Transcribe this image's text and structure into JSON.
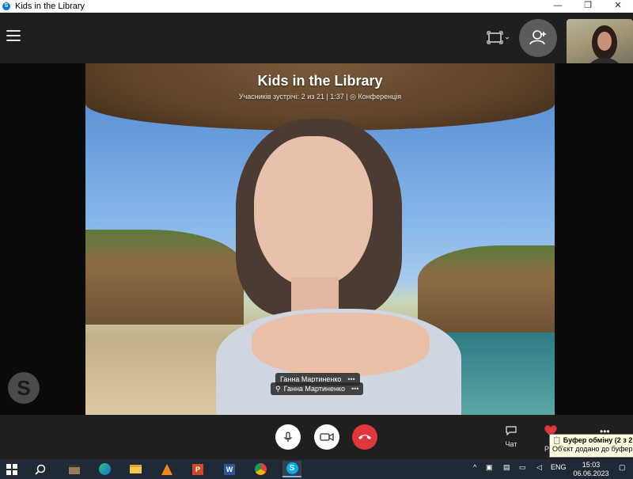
{
  "window": {
    "title": "Kids in the Library",
    "controls": {
      "minimize": "—",
      "maximize": "❐",
      "close": "✕"
    }
  },
  "call": {
    "title": "Kids in the Library",
    "subtitle": "Учасників зустрічі: 2 из 21 | 1:37 | ◎ Конференція"
  },
  "participants": [
    {
      "name": "Ганна Мартиненко",
      "more": "•••"
    },
    {
      "name": "Ганна Мартиненко",
      "more": "•••",
      "muted": true
    }
  ],
  "controls": {
    "chat_label": "Чат",
    "react_label": "Р",
    "more_label": "•••"
  },
  "toast": {
    "title": "Буфер обміну (2 з 2",
    "body": "Об'єкт додано до буфер"
  },
  "taskbar": {
    "lang": "ENG",
    "time": "15:03",
    "date": "06.06.2023",
    "apps": [
      "start-icon",
      "search-icon",
      "clapperboard-icon",
      "edge-icon",
      "file-explorer-icon",
      "vlc-icon",
      "powerpoint-icon",
      "word-icon",
      "chrome-icon",
      "skype-icon"
    ]
  },
  "colors": {
    "accent": "#0078d4",
    "end_call": "#e0373c",
    "bar": "#1f1f1f"
  }
}
